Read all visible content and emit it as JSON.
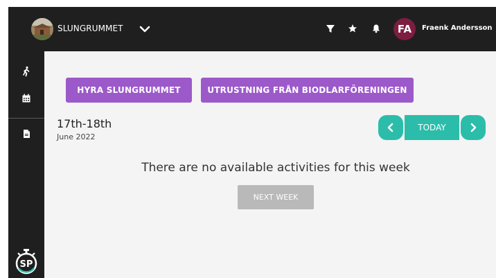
{
  "header": {
    "venue_name": "SLUNGRUMMET",
    "user_initials": "FA",
    "user_name": "Fraenk Andersson"
  },
  "icons": {
    "venue_dropdown": "chevron-down-icon",
    "filter": "filter-icon",
    "favorites": "star-icon",
    "notifications": "bell-icon",
    "sidebar": [
      "running-person-icon",
      "calendar-icon",
      "document-icon"
    ],
    "logo": "sp-stopwatch-logo"
  },
  "actions": {
    "hyra_label": "HYRA SLUNGRUMMET",
    "utrustning_label": "UTRUSTNING FRÅN BIODLARFÖRENINGEN"
  },
  "schedule": {
    "date_range": "17th-18th",
    "month": "June 2022",
    "today_label": "TODAY",
    "empty_message": "There are no available activities for this week",
    "next_week_label": "NEXT WEEK"
  },
  "colors": {
    "bar_bg": "#1f1f1f",
    "content_bg": "#f4f4f4",
    "purple": "#9b59c9",
    "teal": "#2bbdaa",
    "avatar": "#7d1d3f",
    "disabled": "#b9b9b9"
  }
}
